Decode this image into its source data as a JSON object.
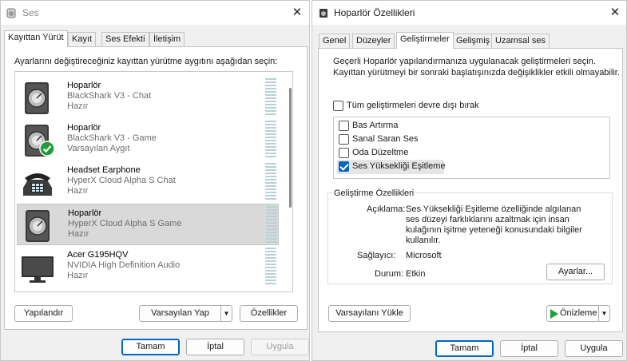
{
  "sound": {
    "title": "Ses",
    "tabs": [
      "Kayıttan Yürüt",
      "Kayıt",
      "Ses Efekti",
      "İletişim"
    ],
    "instruction": "Ayarlarını değiştireceğiniz kayıttan yürütme aygıtını aşağıdan seçin:",
    "devices": [
      {
        "name": "Hoparlör",
        "description": "BlackShark V3 - Chat",
        "status": "Hazır",
        "icon": "speaker-icon"
      },
      {
        "name": "Hoparlör",
        "description": "BlackShark V3 - Game",
        "status": "Varsayılan Aygıt",
        "icon": "speaker-icon",
        "default": true
      },
      {
        "name": "Headset Earphone",
        "description": "HyperX Cloud Alpha S Chat",
        "status": "Hazır",
        "icon": "telephone-icon"
      },
      {
        "name": "Hoparlör",
        "description": "HyperX Cloud Alpha S Game",
        "status": "Hazır",
        "icon": "speaker-icon",
        "selected": true
      },
      {
        "name": "Acer G195HQV",
        "description": "NVIDIA High Definition Audio",
        "status": "Hazır",
        "icon": "monitor-icon"
      }
    ],
    "configure_label": "Yapılandır",
    "set_default_label": "Varsayılan Yap",
    "properties_label": "Özellikler",
    "ok_label": "Tamam",
    "cancel_label": "İptal",
    "apply_label": "Uygula"
  },
  "props": {
    "title": "Hoparlör Özellikleri",
    "tabs": [
      "Genel",
      "Düzeyler",
      "Geliştirmeler",
      "Gelişmiş",
      "Uzamsal ses"
    ],
    "description": "Geçerli Hoparlör yapılandırmanıza uygulanacak geliştirmeleri seçin. Kayıttan yürütmeyi bir sonraki başlatışınızda değişiklikler etkili olmayabilir.",
    "disable_all_label": "Tüm geliştirmeleri devre dışı bırak",
    "enhancements": [
      {
        "label": "Bas Artırma",
        "checked": false
      },
      {
        "label": "Sanal Saran Ses",
        "checked": false
      },
      {
        "label": "Oda Düzeltme",
        "checked": false
      },
      {
        "label": "Ses Yüksekliği Eşitleme",
        "checked": true
      }
    ],
    "group_title": "Geliştirme Özellikleri",
    "description_label": "Açıklama:",
    "description_value": "Ses Yüksekliği Eşitleme özelliğinde algılanan ses düzeyi farklıklarını azaltmak için insan kulağının işitme yeteneği konusundaki bilgiler kullanılır.",
    "provider_label": "Sağlayıcı:",
    "provider_value": "Microsoft",
    "state_label": "Durum:",
    "state_value": "Etkin",
    "settings_label": "Ayarlar...",
    "restore_defaults_label": "Varsayılanı Yükle",
    "preview_label": "Önizleme",
    "ok_label": "Tamam",
    "cancel_label": "İptal",
    "apply_label": "Uygula"
  },
  "colors": {
    "accent": "#0067c0",
    "preview_green": "#1f9d3a",
    "default_badge": "#1f9d3a"
  }
}
